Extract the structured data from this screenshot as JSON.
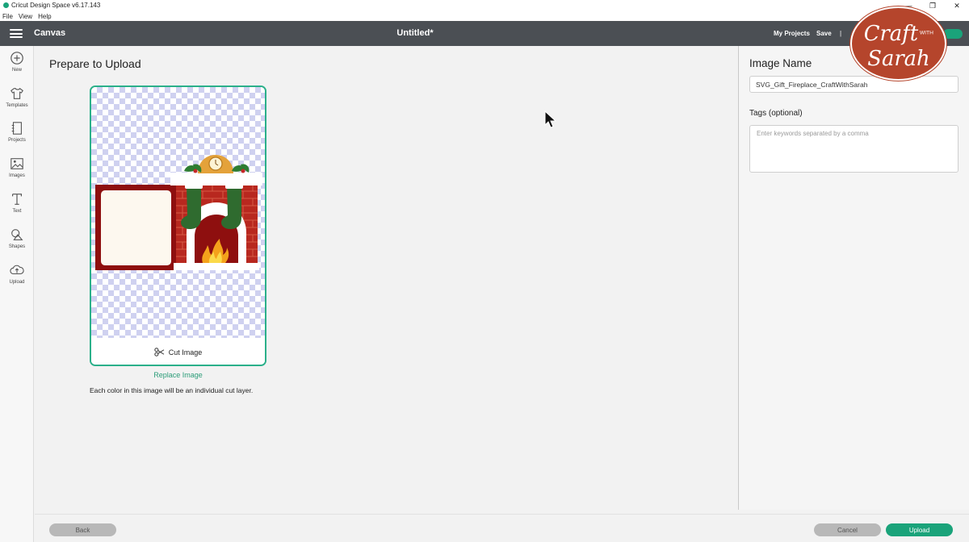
{
  "window": {
    "title": "Cricut Design Space  v6.17.143",
    "menu": [
      "File",
      "View",
      "Help"
    ],
    "controls": [
      "—",
      "❐",
      "✕"
    ]
  },
  "header": {
    "section": "Canvas",
    "project_title": "Untitled*",
    "my_projects": "My Projects",
    "save": "Save",
    "separator": "|"
  },
  "brand": {
    "line1": "Craft",
    "line2": "WITH",
    "line3": "Sarah",
    "color": "#b5452c"
  },
  "sidebar": {
    "items": [
      {
        "label": "New",
        "icon": "plus-circle-icon"
      },
      {
        "label": "Templates",
        "icon": "shirt-icon"
      },
      {
        "label": "Projects",
        "icon": "notebook-icon"
      },
      {
        "label": "Images",
        "icon": "image-icon"
      },
      {
        "label": "Text",
        "icon": "text-t-icon"
      },
      {
        "label": "Shapes",
        "icon": "shapes-icon"
      },
      {
        "label": "Upload",
        "icon": "cloud-upload-icon"
      }
    ]
  },
  "main": {
    "heading": "Prepare to Upload",
    "cut_image_label": "Cut Image",
    "replace_link": "Replace Image",
    "info": "Each color in this image will be an individual cut layer."
  },
  "right_panel": {
    "image_name_heading": "Image Name",
    "image_name_value": "SVG_Gift_Fireplace_CraftWithSarah",
    "tags_label": "Tags (optional)",
    "tags_placeholder": "Enter keywords separated by a comma"
  },
  "footer": {
    "back": "Back",
    "cancel": "Cancel",
    "upload": "Upload"
  },
  "colors": {
    "accent": "#1aa37a",
    "header_bg": "#4b4f54",
    "card_border": "#2bb08a"
  }
}
